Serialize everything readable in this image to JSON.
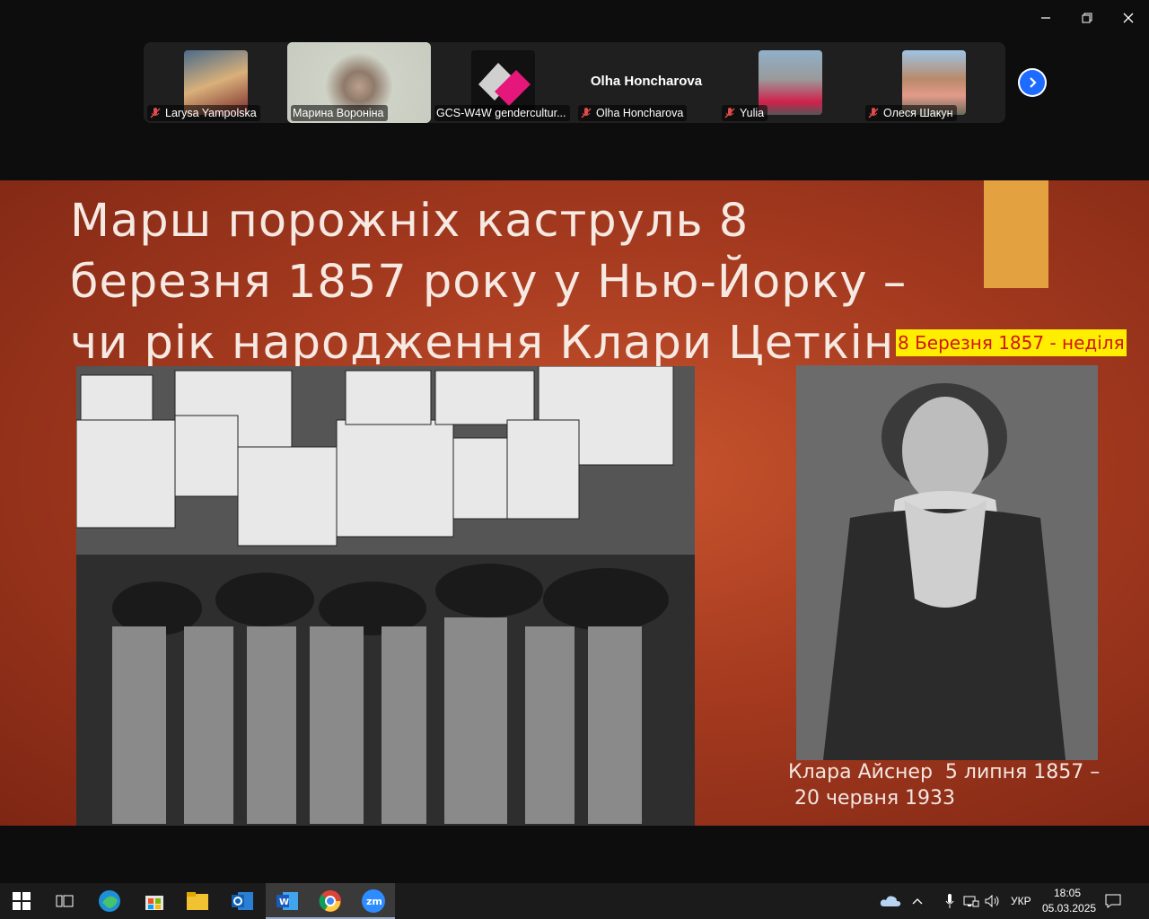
{
  "window": {
    "minimize_icon": "minimize-icon",
    "restore_icon": "restore-icon",
    "close_icon": "close-icon"
  },
  "participants": [
    {
      "name": "Larysa Yampolska",
      "muted": true
    },
    {
      "name": "Марина Вороніна",
      "muted": false,
      "active": true
    },
    {
      "name": "GCS-W4W gendercultur...",
      "muted": false
    },
    {
      "name": "Olha Honcharova",
      "muted": true,
      "display_name": "Olha Honcharova"
    },
    {
      "name": "Yulia",
      "muted": true
    },
    {
      "name": "Олеся Шакун",
      "muted": true
    }
  ],
  "slide": {
    "title_lines": [
      "Марш порожніх каструль 8",
      "березня 1857 року у Нью-Йорку –",
      "чи рік народження Клари Цеткін"
    ],
    "highlight": "8 Березня 1857 - неділя",
    "caption": "Клара Айснер  5 липня 1857 –\n 20 червня 1933",
    "colors": {
      "background": "#b0401f",
      "highlight_bg": "#ffee00",
      "highlight_text": "#d01515",
      "accent_bar": "#e3a23f"
    }
  },
  "taskbar": {
    "apps": [
      "start-icon",
      "task-view-icon",
      "edge-icon",
      "store-icon",
      "file-explorer-icon",
      "outlook-icon",
      "word-icon",
      "chrome-icon",
      "zoom-icon"
    ],
    "language": "УКР",
    "time": "18:05",
    "date": "05.03.2025"
  }
}
